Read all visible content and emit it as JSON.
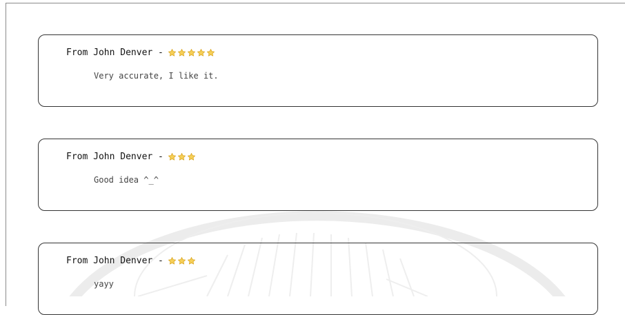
{
  "reviews": [
    {
      "author_line": "From John Denver -",
      "rating": 5,
      "text": "Very accurate, I like it."
    },
    {
      "author_line": "From John Denver -",
      "rating": 3,
      "text": "Good idea ^_^"
    },
    {
      "author_line": "From John Denver -",
      "rating": 3,
      "text": "yayy"
    }
  ],
  "colors": {
    "star_fill": "#f6cf57",
    "star_stroke": "#d9a520",
    "border": "#333333"
  },
  "icons": {
    "rating": "star-icon"
  }
}
